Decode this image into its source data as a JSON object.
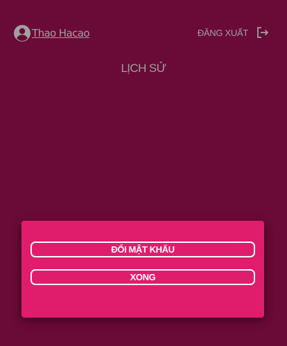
{
  "header": {
    "user_name": "Thao Hacao",
    "user_icon": "account-circle-icon",
    "logout_label": "ĐĂNG XUẤT",
    "logout_icon": "logout-icon"
  },
  "page": {
    "title": "LỊCH SỬ"
  },
  "panel": {
    "change_password_label": "ĐỔI MẬT KHẨU",
    "done_label": "XONG"
  },
  "colors": {
    "background": "#6a0a36",
    "panel": "#e01c6d",
    "muted_text": "#a0a0a0",
    "button_border": "#ffffff"
  }
}
